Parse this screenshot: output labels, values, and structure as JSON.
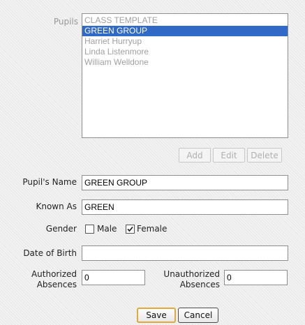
{
  "pupils": {
    "label": "Pupils",
    "items": [
      {
        "label": "CLASS TEMPLATE",
        "selected": false
      },
      {
        "label": "GREEN GROUP",
        "selected": true
      },
      {
        "label": "Harriet Hurryup",
        "selected": false
      },
      {
        "label": "Linda Listenmore",
        "selected": false
      },
      {
        "label": "William Welldone",
        "selected": false
      }
    ]
  },
  "list_buttons": {
    "add": "Add",
    "edit": "Edit",
    "delete": "Delete"
  },
  "fields": {
    "pupils_name": {
      "label": "Pupil's Name",
      "value": "GREEN GROUP"
    },
    "known_as": {
      "label": "Known As",
      "value": "GREEN"
    },
    "gender": {
      "label": "Gender",
      "male_label": "Male",
      "male_checked": false,
      "female_label": "Female",
      "female_checked": true
    },
    "date_of_birth": {
      "label": "Date of Birth",
      "value": ""
    },
    "authorized_absences": {
      "label_line1": "Authorized",
      "label_line2": "Absences",
      "value": "0"
    },
    "unauthorized_absences": {
      "label_line1": "Unauthorized",
      "label_line2": "Absences",
      "value": "0"
    }
  },
  "actions": {
    "save": "Save",
    "cancel": "Cancel"
  },
  "colors": {
    "selection": "#3169c6",
    "focus_border": "#e0a93a"
  }
}
